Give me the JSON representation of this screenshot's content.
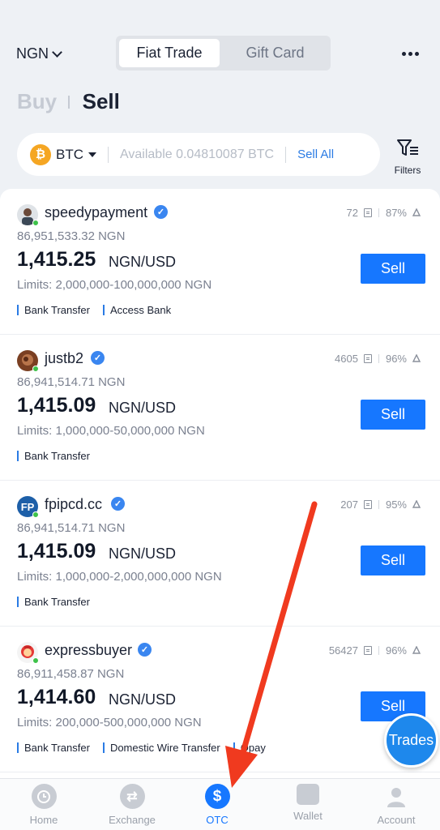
{
  "header": {
    "currency": "NGN",
    "tabs": [
      "Fiat Trade",
      "Gift Card"
    ],
    "active_tab": "Fiat Trade"
  },
  "mode": {
    "buy_label": "Buy",
    "sell_label": "Sell",
    "active": "Sell"
  },
  "search": {
    "coin": "BTC",
    "coin_symbol": "₿",
    "available_text": "Available 0.04810087 BTC",
    "sell_all_label": "Sell All",
    "filters_label": "Filters"
  },
  "offers": [
    {
      "name": "speedypayment",
      "orders": "72",
      "completion": "87%",
      "amount": "86,951,533.32  NGN",
      "price": "1,415.25",
      "unit": "NGN/USD",
      "limits": "Limits: 2,000,000-100,000,000 NGN",
      "tags": [
        "Bank Transfer",
        "Access Bank"
      ],
      "button": "Sell"
    },
    {
      "name": "justb2",
      "orders": "4605",
      "completion": "96%",
      "amount": "86,941,514.71  NGN",
      "price": "1,415.09",
      "unit": "NGN/USD",
      "limits": "Limits: 1,000,000-50,000,000 NGN",
      "tags": [
        "Bank Transfer"
      ],
      "button": "Sell"
    },
    {
      "name": "fpipcd.cc",
      "avatar_text": "FP",
      "orders": "207",
      "completion": "95%",
      "amount": "86,941,514.71  NGN",
      "price": "1,415.09",
      "unit": "NGN/USD",
      "limits": "Limits: 1,000,000-2,000,000,000 NGN",
      "tags": [
        "Bank Transfer"
      ],
      "button": "Sell"
    },
    {
      "name": "expressbuyer",
      "orders": "56427",
      "completion": "96%",
      "amount": "86,911,458.87  NGN",
      "price": "1,414.60",
      "unit": "NGN/USD",
      "limits": "Limits: 200,000-500,000,000 NGN",
      "tags": [
        "Bank Transfer",
        "Domestic Wire Transfer",
        "Opay"
      ],
      "button": "Sell"
    }
  ],
  "floating": {
    "trades_label": "Trades"
  },
  "nav": {
    "items": [
      {
        "label": "Home"
      },
      {
        "label": "Exchange"
      },
      {
        "label": "OTC"
      },
      {
        "label": "Wallet"
      },
      {
        "label": "Account"
      }
    ],
    "active": "OTC"
  },
  "colors": {
    "accent": "#1677ff",
    "annotation_arrow": "#f03a1f",
    "online": "#3ec24a",
    "btc": "#f5a623"
  }
}
